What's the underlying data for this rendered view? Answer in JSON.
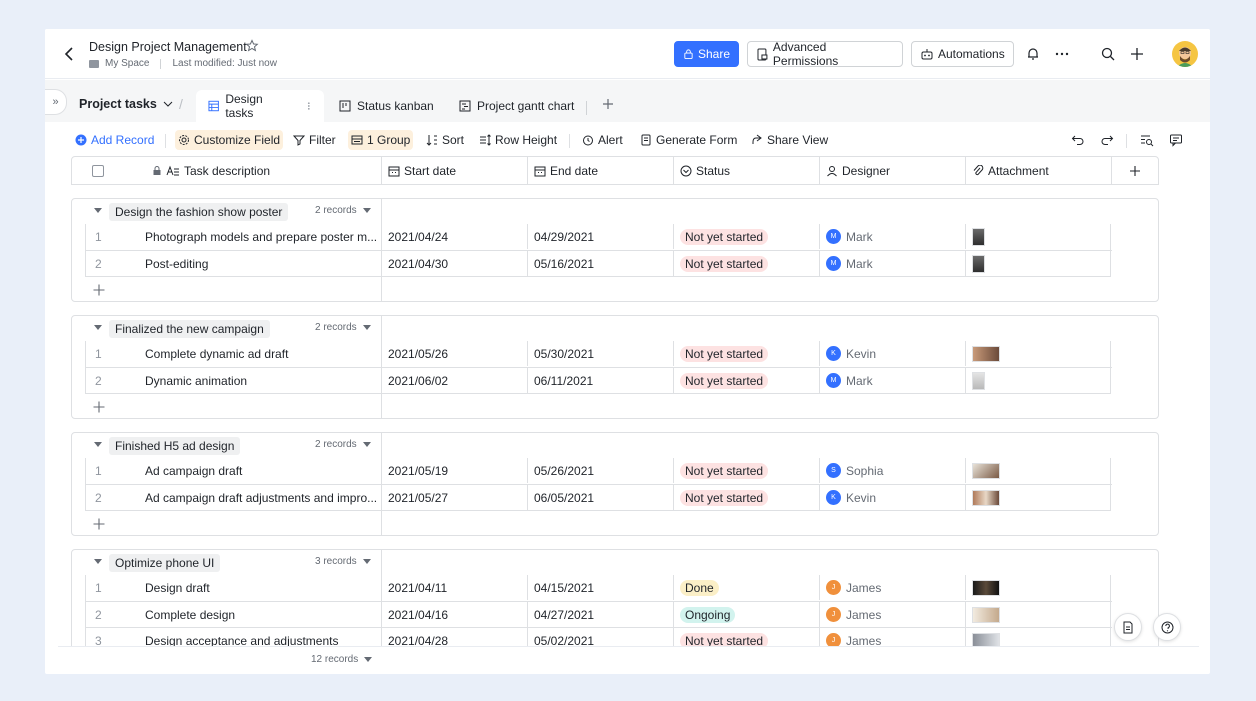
{
  "header": {
    "title": "Design Project Management",
    "space": "My Space",
    "modified": "Last modified: Just now",
    "share_label": "Share",
    "permissions_label": "Advanced Permissions",
    "automations_label": "Automations"
  },
  "tabbar": {
    "table_name": "Project tasks",
    "tabs": [
      {
        "label": "Design tasks"
      },
      {
        "label": "Status kanban"
      },
      {
        "label": "Project gantt chart"
      }
    ]
  },
  "toolbar": {
    "add_record": "Add Record",
    "customize_field": "Customize Field",
    "filter": "Filter",
    "group": "1 Group",
    "sort": "Sort",
    "row_height": "Row Height",
    "alert": "Alert",
    "generate_form": "Generate Form",
    "share_view": "Share View"
  },
  "columns": {
    "task": "Task description",
    "start": "Start date",
    "end": "End date",
    "status": "Status",
    "designer": "Designer",
    "attachment": "Attachment"
  },
  "groups": [
    {
      "title": "Design the fashion show poster",
      "count": "2 records",
      "rows": [
        {
          "n": "1",
          "task": "Photograph models and prepare poster m...",
          "start": "2021/04/24",
          "end": "04/29/2021",
          "status": "Not yet started",
          "initial": "M",
          "designer": "Mark"
        },
        {
          "n": "2",
          "task": "Post-editing",
          "start": "2021/04/30",
          "end": "05/16/2021",
          "status": "Not yet started",
          "initial": "M",
          "designer": "Mark"
        }
      ]
    },
    {
      "title": "Finalized the new campaign",
      "count": "2 records",
      "rows": [
        {
          "n": "1",
          "task": "Complete dynamic ad draft",
          "start": "2021/05/26",
          "end": "05/30/2021",
          "status": "Not yet started",
          "initial": "K",
          "designer": "Kevin"
        },
        {
          "n": "2",
          "task": "Dynamic animation",
          "start": "2021/06/02",
          "end": "06/11/2021",
          "status": "Not yet started",
          "initial": "M",
          "designer": "Mark"
        }
      ]
    },
    {
      "title": "Finished H5 ad design",
      "count": "2 records",
      "rows": [
        {
          "n": "1",
          "task": "Ad campaign draft",
          "start": "2021/05/19",
          "end": "05/26/2021",
          "status": "Not yet started",
          "initial": "S",
          "designer": "Sophia"
        },
        {
          "n": "2",
          "task": "Ad campaign draft adjustments and impro...",
          "start": "2021/05/27",
          "end": "06/05/2021",
          "status": "Not yet started",
          "initial": "K",
          "designer": "Kevin"
        }
      ]
    },
    {
      "title": "Optimize phone UI",
      "count": "3 records",
      "rows": [
        {
          "n": "1",
          "task": "Design draft",
          "start": "2021/04/11",
          "end": "04/15/2021",
          "status": "Done",
          "initial": "J",
          "designer": "James"
        },
        {
          "n": "2",
          "task": "Complete design",
          "start": "2021/04/16",
          "end": "04/27/2021",
          "status": "Ongoing",
          "initial": "J",
          "designer": "James"
        },
        {
          "n": "3",
          "task": "Design acceptance and adjustments",
          "start": "2021/04/28",
          "end": "05/02/2021",
          "status": "Not yet started",
          "initial": "J",
          "designer": "James"
        }
      ]
    }
  ],
  "footer": {
    "total": "12 records"
  },
  "colors": {
    "accent": "#3370ff",
    "blue_user": "#3370ff",
    "orange_user": "#f0903c"
  }
}
